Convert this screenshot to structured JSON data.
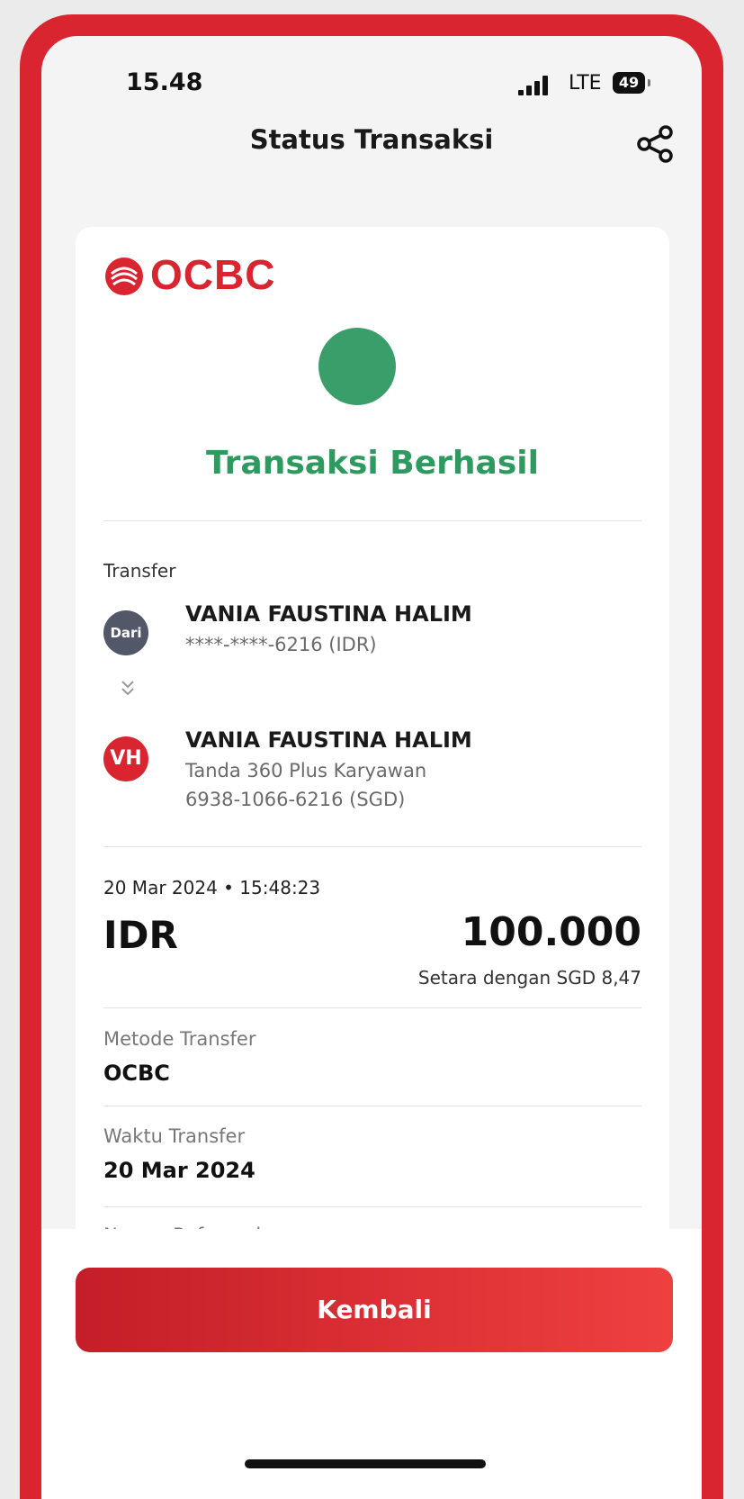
{
  "status_bar": {
    "time": "15.48",
    "network": "LTE",
    "battery": "49"
  },
  "header": {
    "title": "Status Transaksi",
    "share_icon": "share-icon"
  },
  "bank": {
    "logo_text": "OCBC",
    "brand_color": "#d9252f"
  },
  "result": {
    "title": "Transaksi Berhasil",
    "status_color": "#3a9e6b"
  },
  "transfer": {
    "section_label": "Transfer",
    "from": {
      "avatar_text": "Dari",
      "name": "VANIA FAUSTINA HALIM",
      "account": "****-****-6216 (IDR)"
    },
    "to": {
      "avatar_text": "VH",
      "name": "VANIA FAUSTINA HALIM",
      "account_type": "Tanda 360 Plus Karyawan",
      "account": "6938-1066-6216 (SGD)"
    }
  },
  "amount": {
    "datetime": "20 Mar 2024 • 15:48:23",
    "currency": "IDR",
    "value": "100.000",
    "equivalent": "Setara dengan SGD 8,47"
  },
  "details": [
    {
      "label": "Metode Transfer",
      "value": "OCBC"
    },
    {
      "label": "Waktu Transfer",
      "value": "20 Mar 2024"
    },
    {
      "label": "Nomor Referensi",
      "value": ""
    }
  ],
  "footer": {
    "back_label": "Kembali"
  }
}
